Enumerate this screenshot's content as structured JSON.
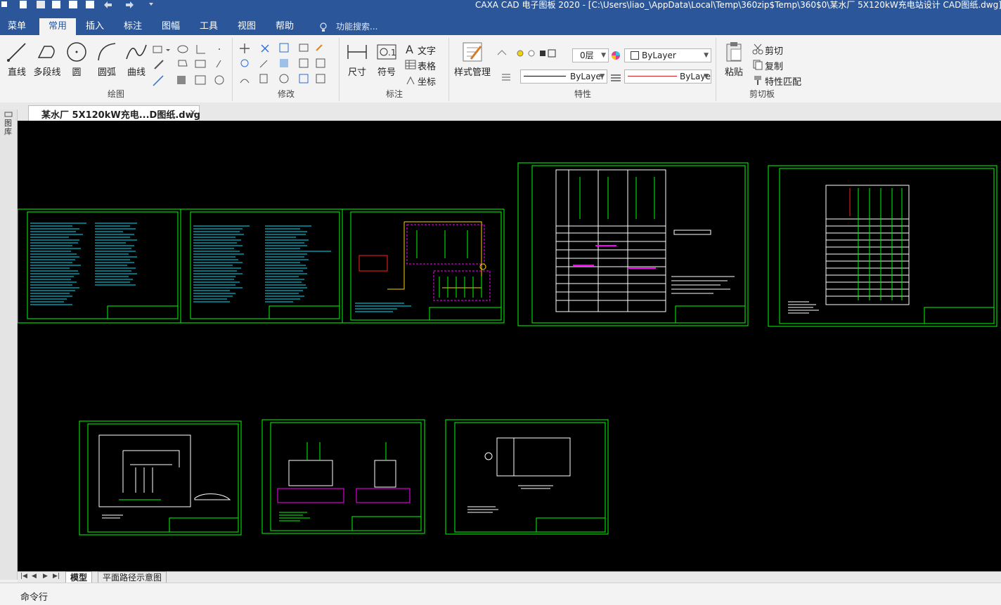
{
  "app": {
    "title": "CAXA CAD 电子图板 2020 - [C:\\Users\\liao_\\AppData\\Local\\Temp\\360zip$Temp\\360$0\\某水厂 5X120kW充电站设计 CAD图纸.dwg]"
  },
  "menu": {
    "tabs": [
      "菜单",
      "常用",
      "插入",
      "标注",
      "图幅",
      "工具",
      "视图",
      "帮助"
    ],
    "active_index": 1,
    "search_placeholder": "功能搜索..."
  },
  "ribbon": {
    "draw": {
      "label": "绘图",
      "buttons": [
        "直线",
        "多段线",
        "圆",
        "圆弧",
        "曲线"
      ]
    },
    "modify": {
      "label": "修改"
    },
    "annotate": {
      "label": "标注",
      "buttons": [
        "尺寸",
        "符号"
      ],
      "small": [
        "文字",
        "表格",
        "坐标"
      ]
    },
    "properties": {
      "label": "特性",
      "style_button": "样式管理",
      "layer": "0层",
      "color": "ByLayer",
      "linetype": "ByLayer",
      "lineweight": "ByLaye"
    },
    "clipboard": {
      "label": "剪切板",
      "paste": "粘贴",
      "small": [
        "剪切",
        "复制",
        "特性匹配"
      ]
    }
  },
  "document": {
    "tab_title": "某水厂 5X120kW充电...D图纸.dwg",
    "sidebar_label": "图库"
  },
  "sheets": {
    "model": "模型",
    "layout": "平面路径示意图"
  },
  "command": {
    "label": "命令行"
  },
  "colors": {
    "accent": "#2b579a",
    "canvas": "#000000",
    "frame": "#00ff00",
    "cyan": "#00e5ff",
    "magenta": "#ff00ff"
  }
}
